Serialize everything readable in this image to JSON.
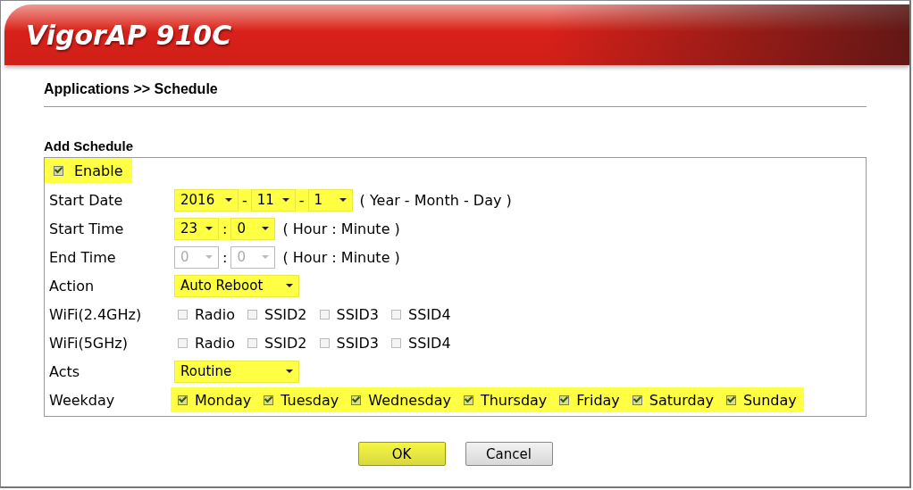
{
  "header": {
    "title": "VigorAP 910C"
  },
  "breadcrumb": "Applications >> Schedule",
  "section_title": "Add Schedule",
  "enable": {
    "label": "Enable",
    "checked": true,
    "highlighted": true
  },
  "rows": [
    {
      "kind": "selects",
      "label": "Start Date",
      "highlighted": true,
      "selects": [
        {
          "value": "2016",
          "disabled": false
        },
        {
          "value": "11",
          "disabled": false
        },
        {
          "value": "1",
          "disabled": false
        }
      ],
      "separators": [
        "-",
        "-"
      ],
      "hint": "( Year - Month - Day )"
    },
    {
      "kind": "selects",
      "label": "Start Time",
      "highlighted": true,
      "selects": [
        {
          "value": "23",
          "disabled": false
        },
        {
          "value": "0",
          "disabled": false
        }
      ],
      "separators": [
        ":"
      ],
      "hint": "( Hour : Minute )"
    },
    {
      "kind": "selects",
      "label": "End Time",
      "highlighted": false,
      "selects": [
        {
          "value": "0",
          "disabled": true
        },
        {
          "value": "0",
          "disabled": true
        }
      ],
      "separators": [
        ":"
      ],
      "hint": "( Hour : Minute )"
    },
    {
      "kind": "selects",
      "label": "Action",
      "highlighted": true,
      "selects": [
        {
          "value": "Auto Reboot",
          "disabled": false
        }
      ],
      "separators": []
    },
    {
      "kind": "checks",
      "label": "WiFi(2.4GHz)",
      "highlighted": false,
      "options": [
        {
          "label": "Radio",
          "checked": false
        },
        {
          "label": "SSID2",
          "checked": false
        },
        {
          "label": "SSID3",
          "checked": false
        },
        {
          "label": "SSID4",
          "checked": false
        }
      ]
    },
    {
      "kind": "checks",
      "label": "WiFi(5GHz)",
      "highlighted": false,
      "options": [
        {
          "label": "Radio",
          "checked": false
        },
        {
          "label": "SSID2",
          "checked": false
        },
        {
          "label": "SSID3",
          "checked": false
        },
        {
          "label": "SSID4",
          "checked": false
        }
      ]
    },
    {
      "kind": "selects",
      "label": "Acts",
      "highlighted": true,
      "selects": [
        {
          "value": "Routine",
          "disabled": false
        }
      ],
      "separators": []
    },
    {
      "kind": "checks",
      "label": "Weekday",
      "highlighted": true,
      "options": [
        {
          "label": "Monday",
          "checked": true
        },
        {
          "label": "Tuesday",
          "checked": true
        },
        {
          "label": "Wednesday",
          "checked": true
        },
        {
          "label": "Thursday",
          "checked": true
        },
        {
          "label": "Friday",
          "checked": true
        },
        {
          "label": "Saturday",
          "checked": true
        },
        {
          "label": "Sunday",
          "checked": true
        }
      ]
    }
  ],
  "buttons": [
    {
      "label": "OK",
      "highlighted": true
    },
    {
      "label": "Cancel",
      "highlighted": false
    }
  ]
}
